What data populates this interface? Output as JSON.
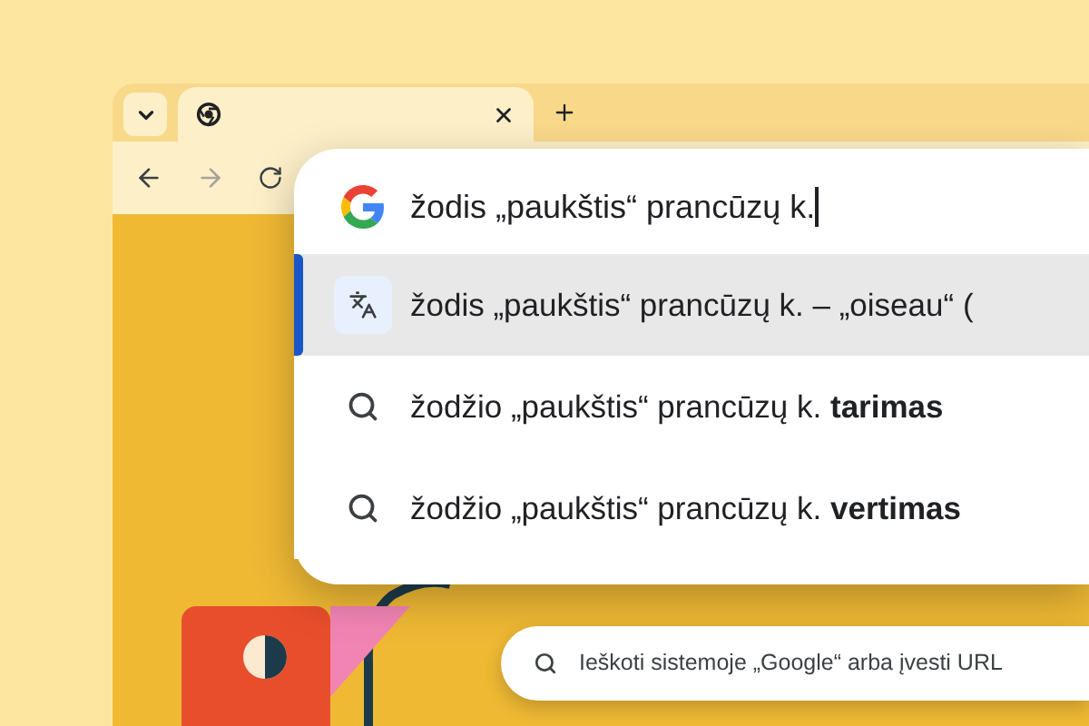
{
  "tab_strip": {
    "tabs": [
      {
        "selected": true
      }
    ]
  },
  "omnibox": {
    "query": "žodis „paukštis“ prancūzų k.",
    "suggestions": [
      {
        "kind": "translate",
        "text": "žodis „paukštis“ prancūzų k. – „oiseau“ (",
        "selected": true
      },
      {
        "kind": "search",
        "text": "žodžio „paukštis“ prancūzų k. **tarimas**",
        "selected": false
      },
      {
        "kind": "search",
        "text": "žodžio „paukštis“ prancūzų k. **vertimas**",
        "selected": false
      }
    ]
  },
  "page": {
    "search_placeholder": "Ieškoti sistemoje „Google“ arba įvesti URL"
  }
}
